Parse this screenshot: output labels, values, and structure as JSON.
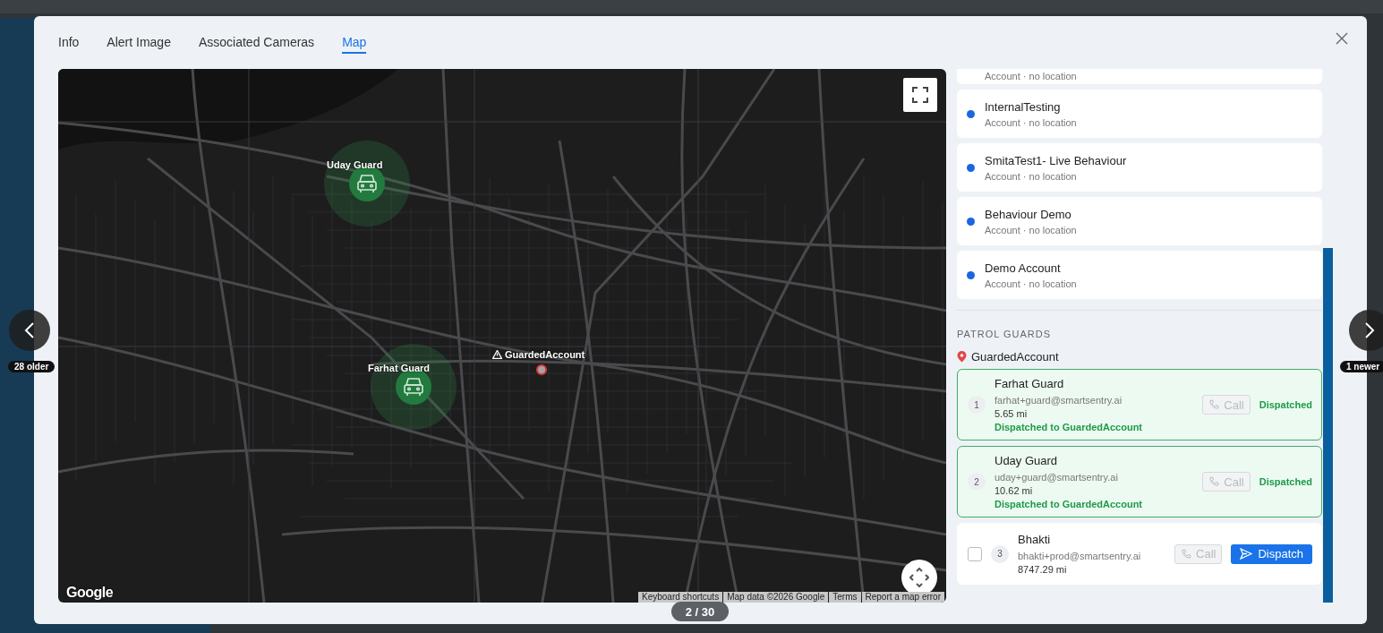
{
  "tabs": [
    {
      "label": "Info",
      "selected": false
    },
    {
      "label": "Alert Image",
      "selected": false
    },
    {
      "label": "Associated Cameras",
      "selected": false
    },
    {
      "label": "Map",
      "selected": true
    }
  ],
  "map": {
    "markers": [
      {
        "kind": "guard",
        "label": "Uday Guard"
      },
      {
        "kind": "guard",
        "label": "Farhat Guard"
      },
      {
        "kind": "site",
        "label": "GuardedAccount"
      }
    ],
    "logo": "Google",
    "attribution": [
      "Keyboard shortcuts",
      "Map data ©2026 Google",
      "Terms",
      "Report a map error"
    ]
  },
  "accounts": [
    {
      "subtitle": "Account · no location"
    },
    {
      "name": "InternalTesting",
      "subtitle": "Account · no location",
      "color": "#1a66e0"
    },
    {
      "name": "SmitaTest1- Live Behaviour",
      "subtitle": "Account · no location",
      "color": "#1a66e0"
    },
    {
      "name": "Behaviour Demo",
      "subtitle": "Account · no location",
      "color": "#1a66e0"
    },
    {
      "name": "Demo Account",
      "subtitle": "Account · no location",
      "color": "#1a66e0"
    }
  ],
  "patrol": {
    "heading": "PATROL GUARDS",
    "site": "GuardedAccount",
    "guards": [
      {
        "kind": "dispatched",
        "number": "1",
        "name": "Farhat Guard",
        "email": "farhat+guard@smartsentry.ai",
        "distance": "5.65 mi",
        "note": "Dispatched to GuardedAccount",
        "call": {
          "label": "Call",
          "disabled": true
        },
        "status": "Dispatched"
      },
      {
        "kind": "dispatched",
        "number": "2",
        "name": "Uday Guard",
        "email": "uday+guard@smartsentry.ai",
        "distance": "10.62 mi",
        "note": "Dispatched to GuardedAccount",
        "call": {
          "label": "Call",
          "disabled": true
        },
        "status": "Dispatched"
      },
      {
        "kind": "available",
        "number": "3",
        "name": "Bhakti",
        "email": "bhakti+prod@smartsentry.ai",
        "distance": "8747.29 mi",
        "checked": false,
        "call": {
          "label": "Call",
          "disabled": true
        },
        "action": "Dispatch"
      }
    ]
  },
  "nav": {
    "older": "28 older",
    "newer": "1 newer"
  },
  "pager": "2 / 30"
}
